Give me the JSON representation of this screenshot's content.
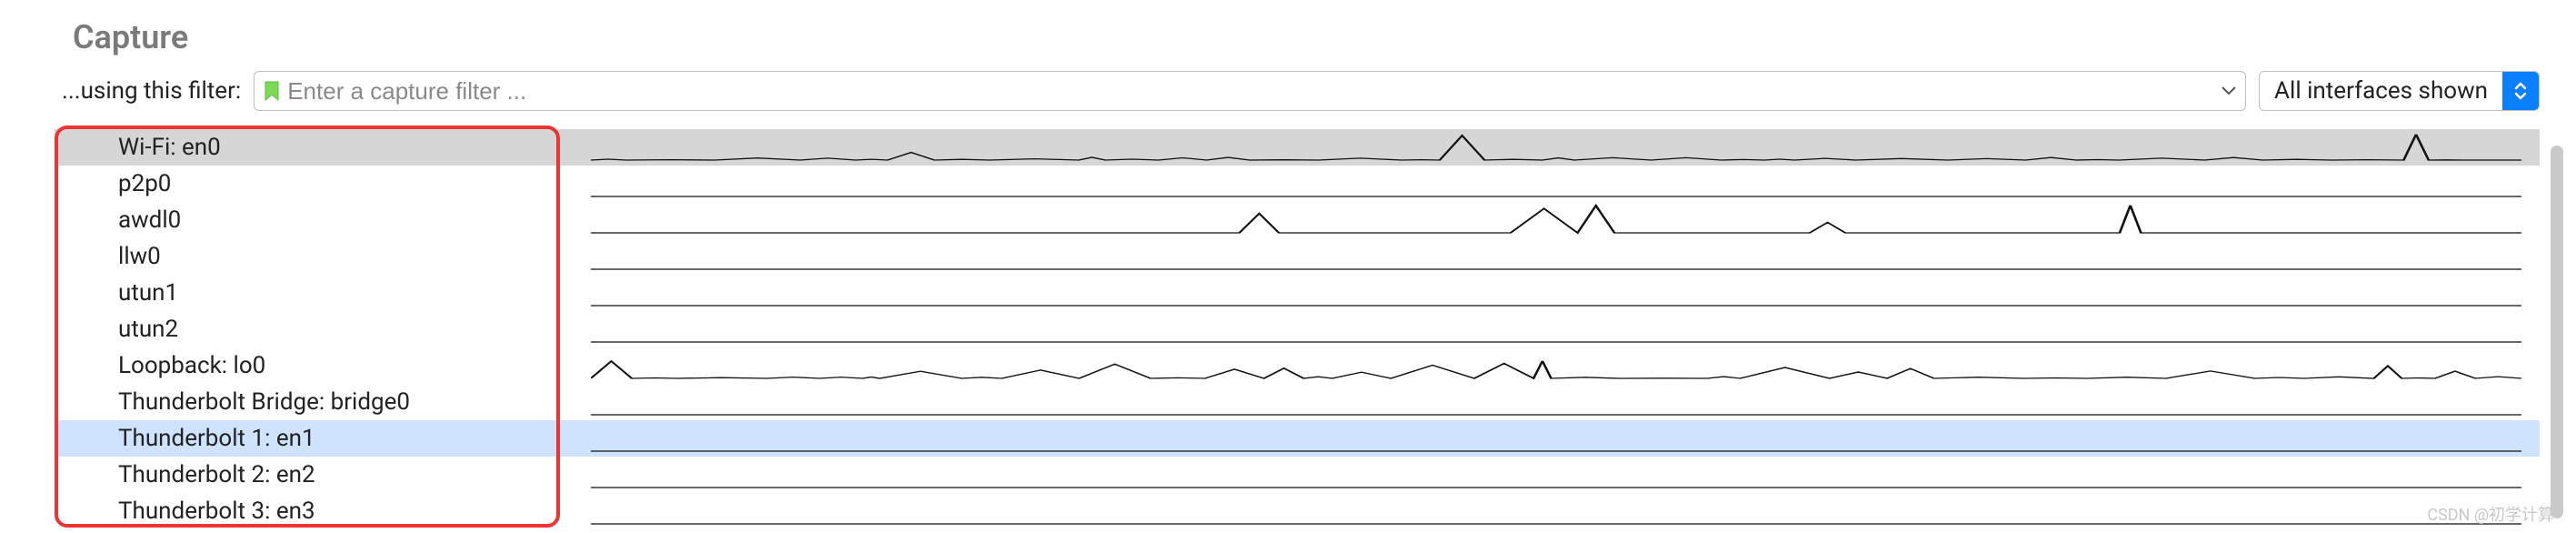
{
  "section_title": "Capture",
  "filter": {
    "label": "...using this filter:",
    "placeholder": "Enter a capture filter ..."
  },
  "interfaces_dropdown_label": "All interfaces shown",
  "interfaces": [
    {
      "name": "Wi-Fi: en0",
      "selected": true,
      "highlighted": false,
      "spark": "wifi"
    },
    {
      "name": "p2p0",
      "selected": false,
      "highlighted": false,
      "spark": "flat"
    },
    {
      "name": "awdl0",
      "selected": false,
      "highlighted": false,
      "spark": "awd"
    },
    {
      "name": "llw0",
      "selected": false,
      "highlighted": false,
      "spark": "flat"
    },
    {
      "name": "utun1",
      "selected": false,
      "highlighted": false,
      "spark": "flat"
    },
    {
      "name": "utun2",
      "selected": false,
      "highlighted": false,
      "spark": "flat"
    },
    {
      "name": "Loopback: lo0",
      "selected": false,
      "highlighted": false,
      "spark": "loop"
    },
    {
      "name": "Thunderbolt Bridge: bridge0",
      "selected": false,
      "highlighted": false,
      "spark": "flat"
    },
    {
      "name": "Thunderbolt 1: en1",
      "selected": false,
      "highlighted": true,
      "spark": "flat"
    },
    {
      "name": "Thunderbolt 2: en2",
      "selected": false,
      "highlighted": false,
      "spark": "flat"
    },
    {
      "name": "Thunderbolt 3: en3",
      "selected": false,
      "highlighted": false,
      "spark": "flat"
    }
  ],
  "watermark": "CSDN @初学计算"
}
